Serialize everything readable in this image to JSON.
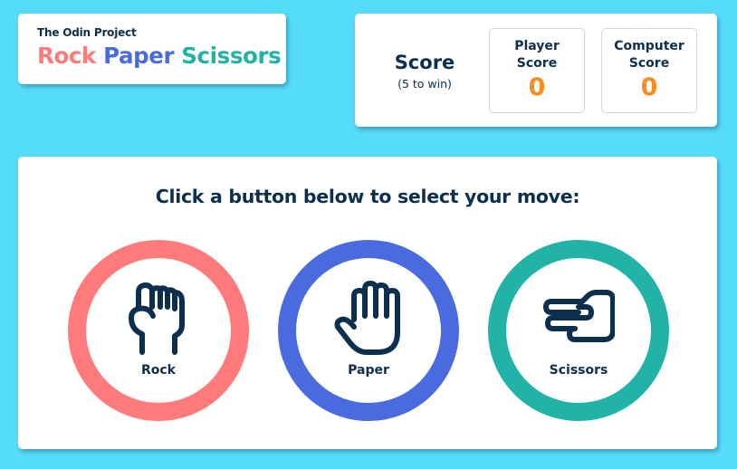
{
  "header": {
    "brand": "The Odin Project",
    "title_parts": {
      "rock": "Rock",
      "paper": "Paper",
      "scissors": "Scissors"
    }
  },
  "score": {
    "label": "Score",
    "subtitle": "(5 to win)",
    "player": {
      "label_line1": "Player",
      "label_line2": "Score",
      "value": "0"
    },
    "computer": {
      "label_line1": "Computer",
      "label_line2": "Score",
      "value": "0"
    }
  },
  "game": {
    "prompt": "Click a button below to select your move:",
    "moves": [
      {
        "label": "Rock",
        "icon": "fist-icon",
        "color": "#ff7b7b"
      },
      {
        "label": "Paper",
        "icon": "open-hand-icon",
        "color": "#4a6ae0"
      },
      {
        "label": "Scissors",
        "icon": "scissors-hand-icon",
        "color": "#22b3a8"
      }
    ]
  },
  "colors": {
    "background": "#55dcfa",
    "text": "#0d2f4f",
    "score_value": "#ff8b1a"
  }
}
